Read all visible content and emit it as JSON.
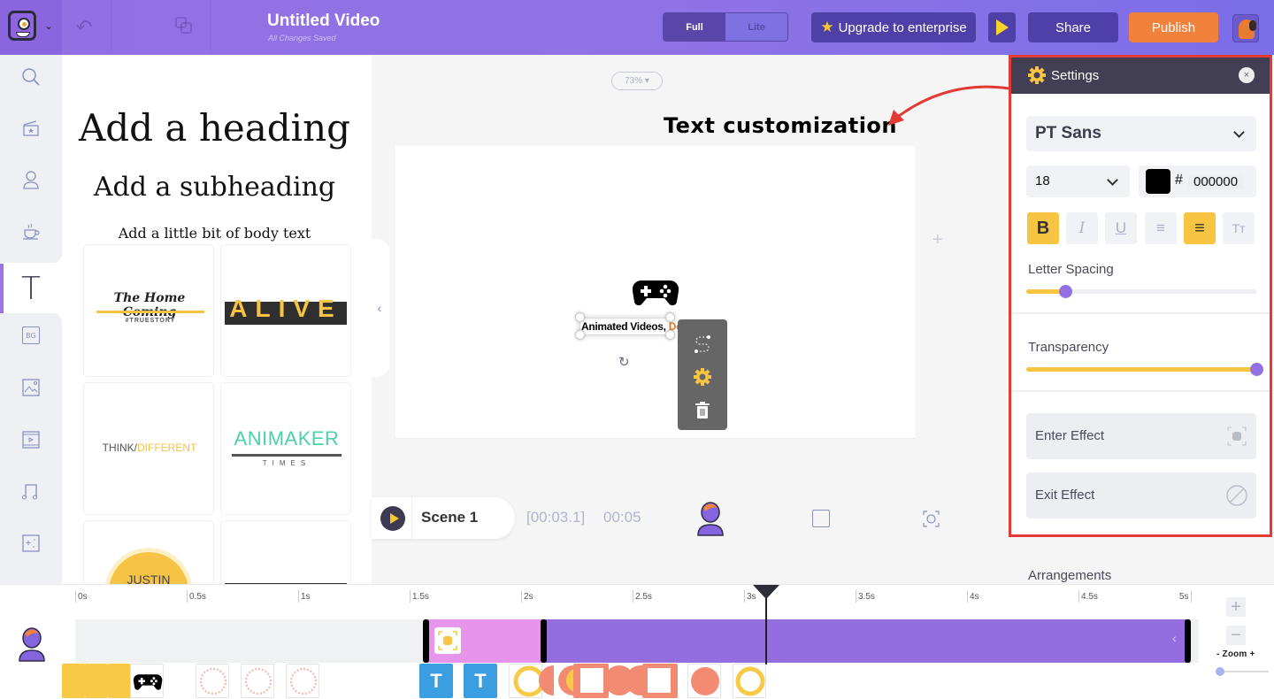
{
  "header": {
    "title": "Untitled Video",
    "save_status": "All Changes Saved",
    "mode_toggle": {
      "full_label": "Full",
      "lite_label": "Lite",
      "selected": "Full"
    },
    "upgrade_label": "Upgrade to enterprise",
    "share_label": "Share",
    "publish_label": "Publish",
    "icons": [
      "app-logo-icon",
      "undo-icon",
      "duplicate-icon",
      "star-icon",
      "play-icon",
      "user-avatar"
    ]
  },
  "sidebar": {
    "items": [
      {
        "icon": "search-icon"
      },
      {
        "icon": "scene-icon"
      },
      {
        "icon": "character-icon"
      },
      {
        "icon": "props-icon"
      },
      {
        "icon": "text-icon",
        "active": true,
        "glyph": "T"
      },
      {
        "icon": "background-icon",
        "glyph": "BG"
      },
      {
        "icon": "image-icon"
      },
      {
        "icon": "video-icon"
      },
      {
        "icon": "music-icon"
      },
      {
        "icon": "effects-icon"
      }
    ]
  },
  "text_panel": {
    "heading": "Add a heading",
    "subheading": "Add a subheading",
    "body": "Add a little bit of body text",
    "templates": [
      {
        "title": "The Home Coming",
        "subtitle": "#TRUESTORY"
      },
      {
        "title": "ALIVE"
      },
      {
        "title_a": "THINK/",
        "title_b": "DIFFERENT"
      },
      {
        "title": "ANIMAKER",
        "subtitle": "TIMES"
      },
      {
        "title": "JUSTIN"
      },
      {
        "title": ""
      }
    ],
    "collapse_icon": "‹"
  },
  "stage": {
    "zoom_level": "73%",
    "annotation": "Text customization",
    "canvas_text_part1": "Animated Videos,",
    "canvas_text_part2": "Done Right!",
    "context_menu": [
      "motion-path-icon",
      "settings-icon",
      "delete-icon"
    ],
    "add_icon": "+"
  },
  "scene_bar": {
    "scene_label": "Scene 1",
    "current_time": "[00:03.1]",
    "total_time": "00:05"
  },
  "settings_panel": {
    "title": "Settings",
    "close_glyph": "×",
    "font_family": "PT Sans",
    "font_size": "18",
    "color_hash": "#",
    "color_hex": "000000",
    "color_value": "#000000",
    "format_buttons": [
      {
        "name": "bold",
        "glyph": "B",
        "active": true
      },
      {
        "name": "italic",
        "glyph": "I",
        "active": false
      },
      {
        "name": "underline",
        "glyph": "U",
        "active": false
      },
      {
        "name": "list",
        "glyph": "≡",
        "active": false
      },
      {
        "name": "align-center",
        "glyph": "≡",
        "active": true
      },
      {
        "name": "text-case",
        "glyph": "Tт",
        "active": false
      }
    ],
    "letter_spacing_label": "Letter Spacing",
    "letter_spacing_value": 0.17,
    "transparency_label": "Transparency",
    "transparency_value": 1.0,
    "enter_effect_label": "Enter Effect",
    "exit_effect_label": "Exit Effect",
    "arrangements_label": "Arrangements"
  },
  "timeline": {
    "ticks": [
      "0s",
      "0.5s",
      "1s",
      "1.5s",
      "2s",
      "2.5s",
      "3s",
      "3.5s",
      "4s",
      "4.5s",
      "5s"
    ],
    "playhead_seconds": 3.1,
    "segments": [
      {
        "type": "enter",
        "start": 1.57,
        "end": 2.1
      },
      {
        "type": "main",
        "start": 2.1,
        "end": 5.0
      }
    ],
    "thumb_T": "T",
    "zoom_label": "- Zoom +",
    "zoom_in": "+",
    "zoom_out": "−",
    "zoom_value": 0.0
  },
  "colors": {
    "brand_purple": "#8f73e6",
    "publish_orange": "#f2813b",
    "accent_yellow": "#f8c543",
    "slider_knob": "#9471e3",
    "highlight_red": "#e53935"
  }
}
